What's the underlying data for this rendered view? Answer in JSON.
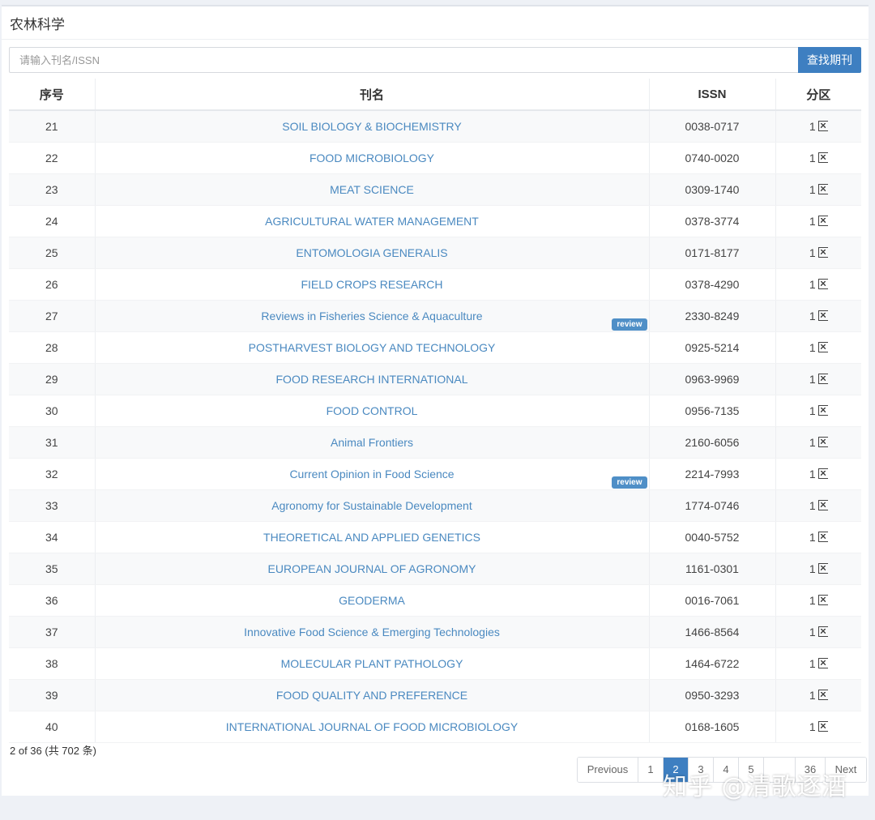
{
  "category_title": "农林科学",
  "search": {
    "placeholder": "请输入刊名/ISSN",
    "button_label": "查找期刊"
  },
  "table": {
    "headers": [
      "序号",
      "刊名",
      "ISSN",
      "分区"
    ],
    "rows": [
      {
        "no": "21",
        "name": "SOIL BIOLOGY & BIOCHEMISTRY",
        "issn": "0038-0717",
        "zone": "1",
        "badge": ""
      },
      {
        "no": "22",
        "name": "FOOD MICROBIOLOGY",
        "issn": "0740-0020",
        "zone": "1",
        "badge": ""
      },
      {
        "no": "23",
        "name": "MEAT SCIENCE",
        "issn": "0309-1740",
        "zone": "1",
        "badge": ""
      },
      {
        "no": "24",
        "name": "AGRICULTURAL WATER MANAGEMENT",
        "issn": "0378-3774",
        "zone": "1",
        "badge": ""
      },
      {
        "no": "25",
        "name": "ENTOMOLOGIA GENERALIS",
        "issn": "0171-8177",
        "zone": "1",
        "badge": ""
      },
      {
        "no": "26",
        "name": "FIELD CROPS RESEARCH",
        "issn": "0378-4290",
        "zone": "1",
        "badge": ""
      },
      {
        "no": "27",
        "name": "Reviews in Fisheries Science & Aquaculture",
        "issn": "2330-8249",
        "zone": "1",
        "badge": "review"
      },
      {
        "no": "28",
        "name": "POSTHARVEST BIOLOGY AND TECHNOLOGY",
        "issn": "0925-5214",
        "zone": "1",
        "badge": ""
      },
      {
        "no": "29",
        "name": "FOOD RESEARCH INTERNATIONAL",
        "issn": "0963-9969",
        "zone": "1",
        "badge": ""
      },
      {
        "no": "30",
        "name": "FOOD CONTROL",
        "issn": "0956-7135",
        "zone": "1",
        "badge": ""
      },
      {
        "no": "31",
        "name": "Animal Frontiers",
        "issn": "2160-6056",
        "zone": "1",
        "badge": ""
      },
      {
        "no": "32",
        "name": "Current Opinion in Food Science",
        "issn": "2214-7993",
        "zone": "1",
        "badge": "review"
      },
      {
        "no": "33",
        "name": "Agronomy for Sustainable Development",
        "issn": "1774-0746",
        "zone": "1",
        "badge": ""
      },
      {
        "no": "34",
        "name": "THEORETICAL AND APPLIED GENETICS",
        "issn": "0040-5752",
        "zone": "1",
        "badge": ""
      },
      {
        "no": "35",
        "name": "EUROPEAN JOURNAL OF AGRONOMY",
        "issn": "1161-0301",
        "zone": "1",
        "badge": ""
      },
      {
        "no": "36",
        "name": "GEODERMA",
        "issn": "0016-7061",
        "zone": "1",
        "badge": ""
      },
      {
        "no": "37",
        "name": "Innovative Food Science & Emerging Technologies",
        "issn": "1466-8564",
        "zone": "1",
        "badge": ""
      },
      {
        "no": "38",
        "name": "MOLECULAR PLANT PATHOLOGY",
        "issn": "1464-6722",
        "zone": "1",
        "badge": ""
      },
      {
        "no": "39",
        "name": "FOOD QUALITY AND PREFERENCE",
        "issn": "0950-3293",
        "zone": "1",
        "badge": ""
      },
      {
        "no": "40",
        "name": "INTERNATIONAL JOURNAL OF FOOD MICROBIOLOGY",
        "issn": "0168-1605",
        "zone": "1",
        "badge": ""
      }
    ]
  },
  "footer": {
    "info": "2 of 36 (共 702 条)"
  },
  "pagination": {
    "items": [
      {
        "label": "Previous",
        "active": false
      },
      {
        "label": "1",
        "active": false
      },
      {
        "label": "2",
        "active": true
      },
      {
        "label": "3",
        "active": false
      },
      {
        "label": "4",
        "active": false
      },
      {
        "label": "5",
        "active": false
      },
      {
        "label": "",
        "active": false
      },
      {
        "label": "36",
        "active": false
      },
      {
        "label": "Next",
        "active": false
      }
    ]
  },
  "watermark": "知乎 @清歌逐酒",
  "colors": {
    "link": "#4a89c0",
    "primary_button": "#3e7fc1",
    "badge": "#4f8fc7"
  }
}
